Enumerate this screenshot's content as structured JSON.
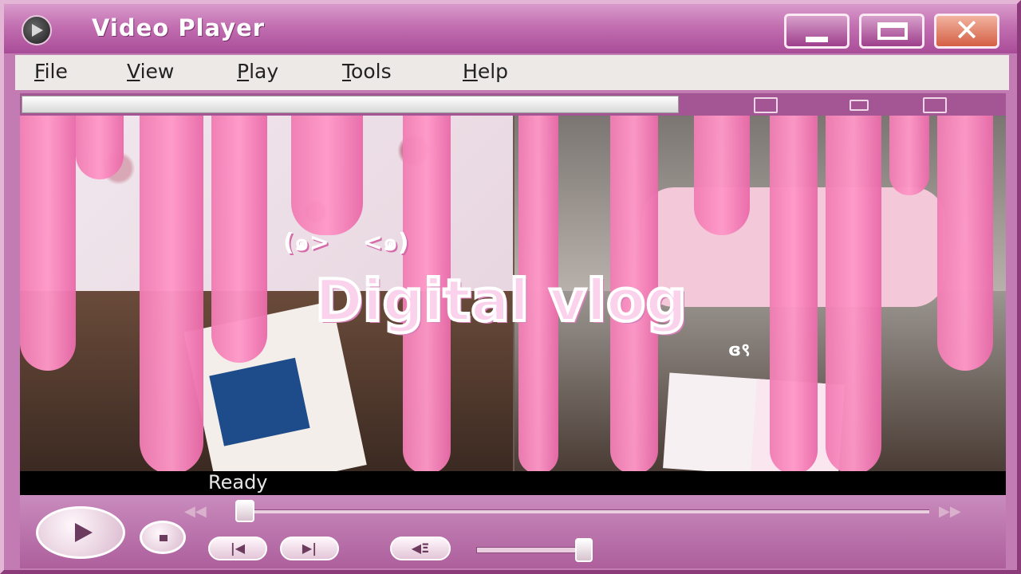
{
  "window": {
    "title": "Video Player",
    "icons": {
      "app": "media-player-icon",
      "minimize": "minimize-icon",
      "maximize": "maximize-icon",
      "close": "close-icon"
    },
    "close_glyph": "✕"
  },
  "menu": {
    "items": [
      {
        "label": "File",
        "access": "F",
        "rest": "ile"
      },
      {
        "label": "View",
        "access": "V",
        "rest": "iew"
      },
      {
        "label": "Play",
        "access": "P",
        "rest": "lay"
      },
      {
        "label": "Tools",
        "access": "T",
        "rest": "ools"
      },
      {
        "label": "Help",
        "access": "H",
        "rest": "elp"
      }
    ]
  },
  "video": {
    "overlay_title": "Digital vlog",
    "kaomoji_left": "(๑>",
    "kaomoji_right": "<๑)",
    "mini_face": "ɞ९",
    "colors": {
      "drip": "#ff98c8",
      "title_fill": "#fbd2ec",
      "frame": "#c37cb3"
    }
  },
  "status": {
    "text": "Ready"
  },
  "controls": {
    "play_icon": "play-icon",
    "stop_icon": "stop-icon",
    "prev_glyph": "|◀",
    "next_glyph": "▶|",
    "mute_glyph": "◀Ξ",
    "rewind_glyph": "◀◀",
    "fastforward_glyph": "▶▶",
    "seek_progress": 0.0,
    "volume_level": 1.0
  }
}
